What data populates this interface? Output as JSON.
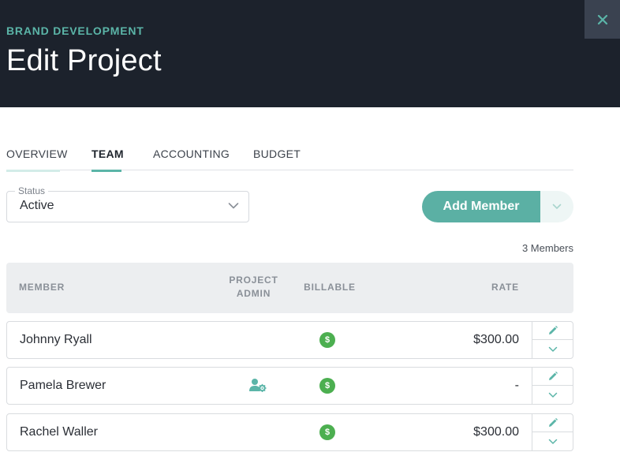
{
  "header": {
    "kicker": "BRAND DEVELOPMENT",
    "title": "Edit Project",
    "close_icon": "close-icon"
  },
  "tabs": [
    {
      "label": "OVERVIEW",
      "active": false
    },
    {
      "label": "TEAM",
      "active": true
    },
    {
      "label": "ACCOUNTING",
      "active": false
    },
    {
      "label": "BUDGET",
      "active": false
    }
  ],
  "status": {
    "legend": "Status",
    "value": "Active"
  },
  "actions": {
    "add_member_label": "Add Member"
  },
  "member_count": "3 Members",
  "table": {
    "headers": {
      "member": "MEMBER",
      "project_admin_line1": "PROJECT",
      "project_admin_line2": "ADMIN",
      "billable": "BILLABLE",
      "rate": "RATE"
    },
    "rows": [
      {
        "name": "Johnny Ryall",
        "admin": false,
        "billable": true,
        "rate": "$300.00"
      },
      {
        "name": "Pamela Brewer",
        "admin": true,
        "billable": true,
        "rate": "-"
      },
      {
        "name": "Rachel Waller",
        "admin": false,
        "billable": true,
        "rate": "$300.00"
      }
    ],
    "billable_glyph": "$"
  },
  "colors": {
    "header_bg": "#1c222c",
    "accent": "#5bb5a8",
    "billable_green": "#4caf50"
  }
}
